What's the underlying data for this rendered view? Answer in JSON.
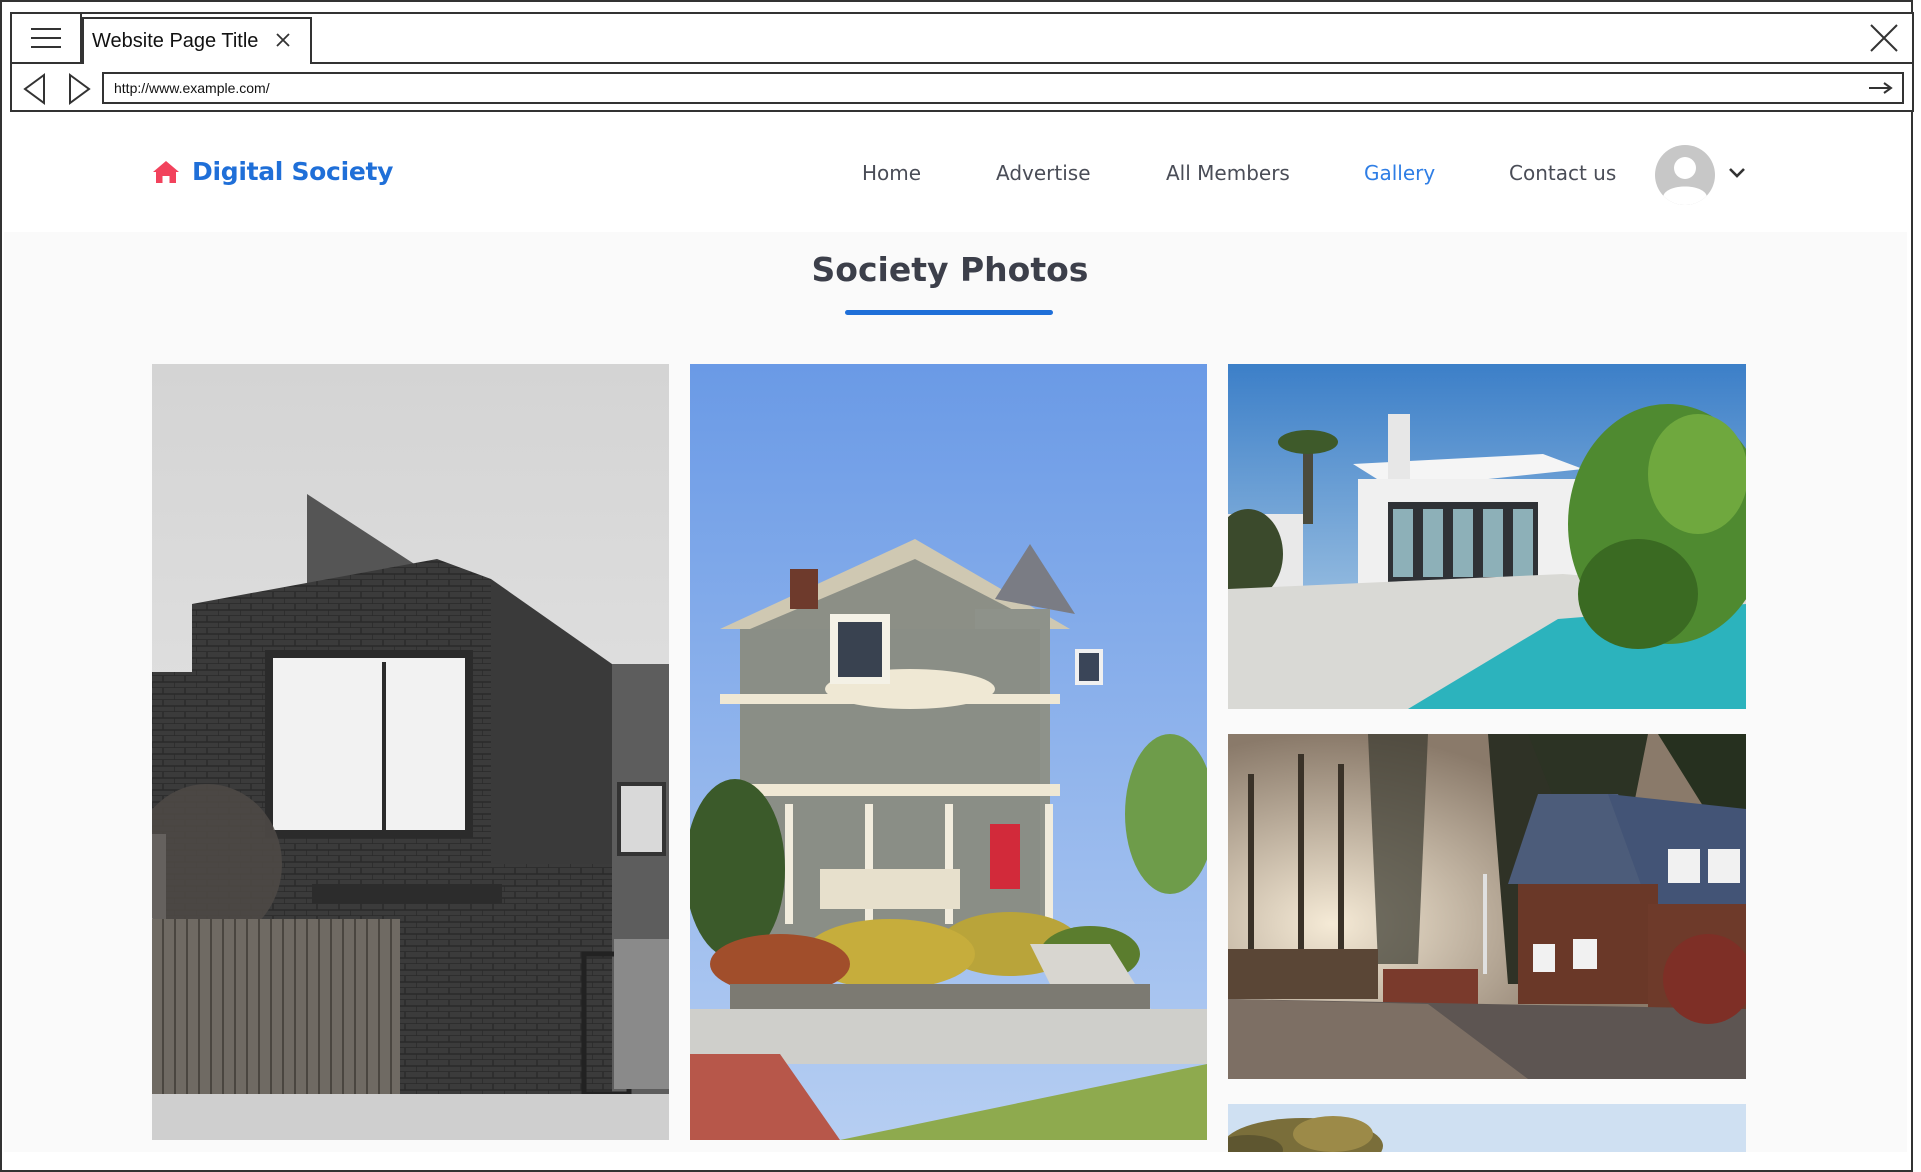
{
  "browser": {
    "tab_title": "Website Page Title",
    "url": "http://www.example.com/"
  },
  "site": {
    "brand": "Digital Society",
    "nav": [
      "Home",
      "Advertise",
      "All Members",
      "Gallery",
      "Contact us"
    ],
    "active_nav": "Gallery"
  },
  "gallery": {
    "title": "Society Photos",
    "photos": [
      "modern-gray-brick-house",
      "victorian-house-with-turret",
      "white-villa-with-pool",
      "wooden-cabin-in-forest",
      "tree-against-sky"
    ]
  },
  "colors": {
    "brand_blue": "#1f6fd8",
    "brand_icon_red": "#f2425c",
    "nav_text": "#4a4d57",
    "nav_active": "#2f7ee5",
    "heading": "#3c3f4a"
  }
}
